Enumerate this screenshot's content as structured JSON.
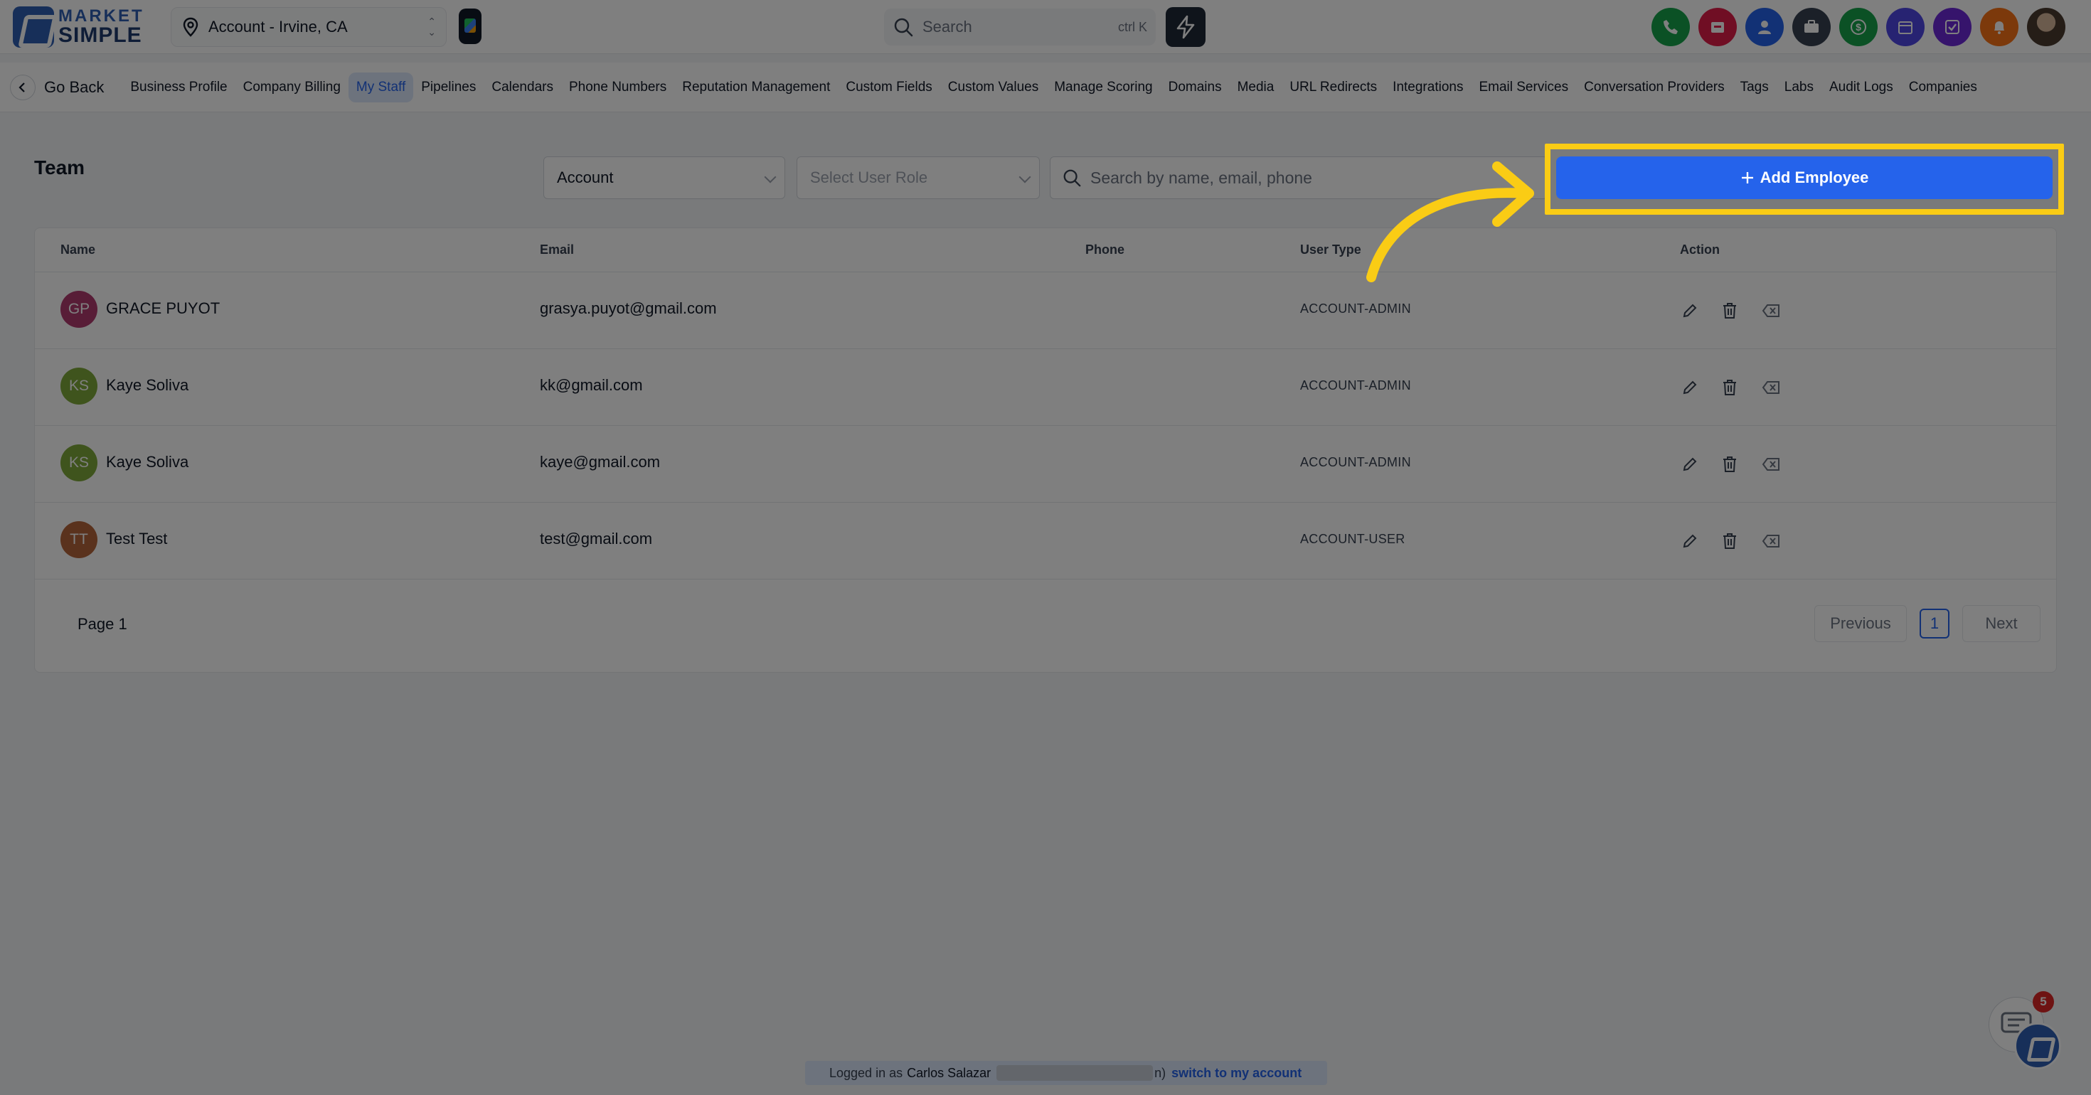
{
  "brand": {
    "line1": "MARKET",
    "line2": "SIMPLE"
  },
  "account_switcher": {
    "label": "Account - Irvine, CA"
  },
  "global_search": {
    "placeholder": "Search",
    "shortcut": "ctrl K"
  },
  "top_icons": [
    {
      "name": "phone-icon",
      "color": "#16a34a"
    },
    {
      "name": "inbox-icon",
      "color": "#e11d48"
    },
    {
      "name": "contacts-icon",
      "color": "#2563eb"
    },
    {
      "name": "briefcase-icon",
      "color": "#374151"
    },
    {
      "name": "dollar-icon",
      "color": "#16a34a"
    },
    {
      "name": "calendar-icon",
      "color": "#4f46e5"
    },
    {
      "name": "tasks-icon",
      "color": "#6d28d9"
    },
    {
      "name": "bell-icon",
      "color": "#f97316"
    }
  ],
  "subnav": {
    "go_back": "Go Back",
    "tabs": [
      "Business Profile",
      "Company Billing",
      "My Staff",
      "Pipelines",
      "Calendars",
      "Phone Numbers",
      "Reputation Management",
      "Custom Fields",
      "Custom Values",
      "Manage Scoring",
      "Domains",
      "Media",
      "URL Redirects",
      "Integrations",
      "Email Services",
      "Conversation Providers",
      "Tags",
      "Labs",
      "Audit Logs",
      "Companies"
    ],
    "active_tab": "My Staff"
  },
  "team": {
    "title": "Team",
    "filter_account": "Account",
    "filter_role_placeholder": "Select User Role",
    "search_placeholder": "Search by name, email, phone",
    "add_button": "Add Employee"
  },
  "table": {
    "columns": [
      "Name",
      "Email",
      "Phone",
      "User Type",
      "Action"
    ],
    "rows": [
      {
        "initials": "GP",
        "name": "GRACE PUYOT",
        "email": "grasya.puyot@gmail.com",
        "phone": "",
        "type": "ACCOUNT-ADMIN",
        "avatar_color": "#b03a6f"
      },
      {
        "initials": "KS",
        "name": "Kaye Soliva",
        "email": "kk@gmail.com",
        "phone": "",
        "type": "ACCOUNT-ADMIN",
        "avatar_color": "#7fa83a"
      },
      {
        "initials": "KS",
        "name": "Kaye Soliva",
        "email": "kaye@gmail.com",
        "phone": "",
        "type": "ACCOUNT-ADMIN",
        "avatar_color": "#7fa83a"
      },
      {
        "initials": "TT",
        "name": "Test Test",
        "email": "test@gmail.com",
        "phone": "",
        "type": "ACCOUNT-USER",
        "avatar_color": "#b5643a"
      }
    ]
  },
  "pagination": {
    "label": "Page 1",
    "previous": "Previous",
    "current": "1",
    "next": "Next"
  },
  "login_banner": {
    "prefix": "Logged in as",
    "user": "Carlos Salazar",
    "suffix": "n)",
    "switch": "switch to my account"
  },
  "chat": {
    "badge": "5"
  },
  "colors": {
    "accent": "#2563eb",
    "highlight": "#facc15"
  }
}
